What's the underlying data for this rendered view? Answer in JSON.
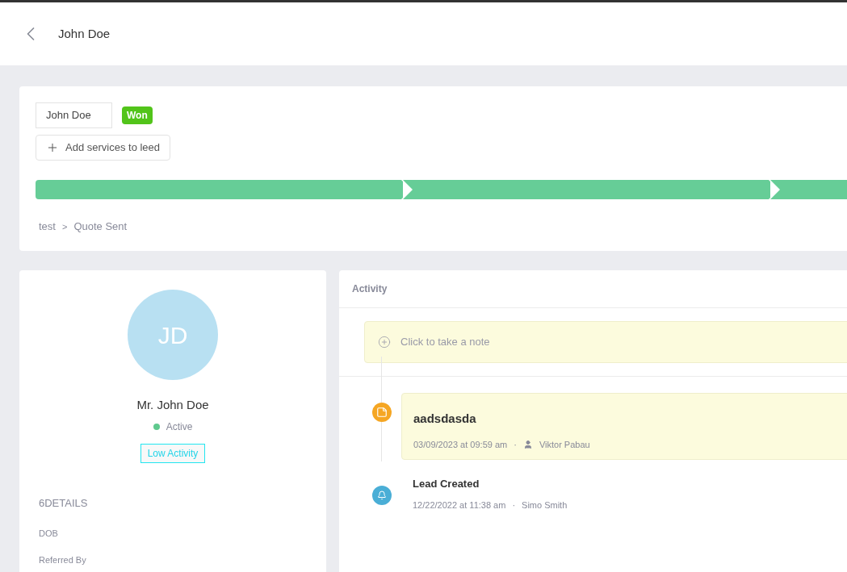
{
  "header": {
    "title": "John Doe"
  },
  "lead": {
    "name": "John Doe",
    "status": "Won",
    "add_button": "Add services to leed"
  },
  "pipeline": {
    "stages": [
      {
        "completed": true
      },
      {
        "completed": true
      },
      {
        "completed": true
      }
    ],
    "breadcrumb": [
      "test",
      "Quote Sent"
    ],
    "separator": ">"
  },
  "profile": {
    "initials": "JD",
    "name": "Mr. John Doe",
    "status": {
      "label": "Active",
      "color": "#5fc98e"
    },
    "activity_tag": "Low Activity",
    "details_title": "6DETAILS",
    "fields": [
      "DOB",
      "Referred By"
    ]
  },
  "activity": {
    "title": "Activity",
    "note_placeholder": "Click to take a note",
    "items": [
      {
        "kind": "note",
        "title": "aadsdasda",
        "time": "03/09/2023 at 09:59 am",
        "separator": "·",
        "author": "Viktor Pabau"
      },
      {
        "kind": "event",
        "title": "Lead Created",
        "time": "12/22/2022 at 11:38 am",
        "separator": "·",
        "author": "Simo Smith"
      }
    ]
  }
}
